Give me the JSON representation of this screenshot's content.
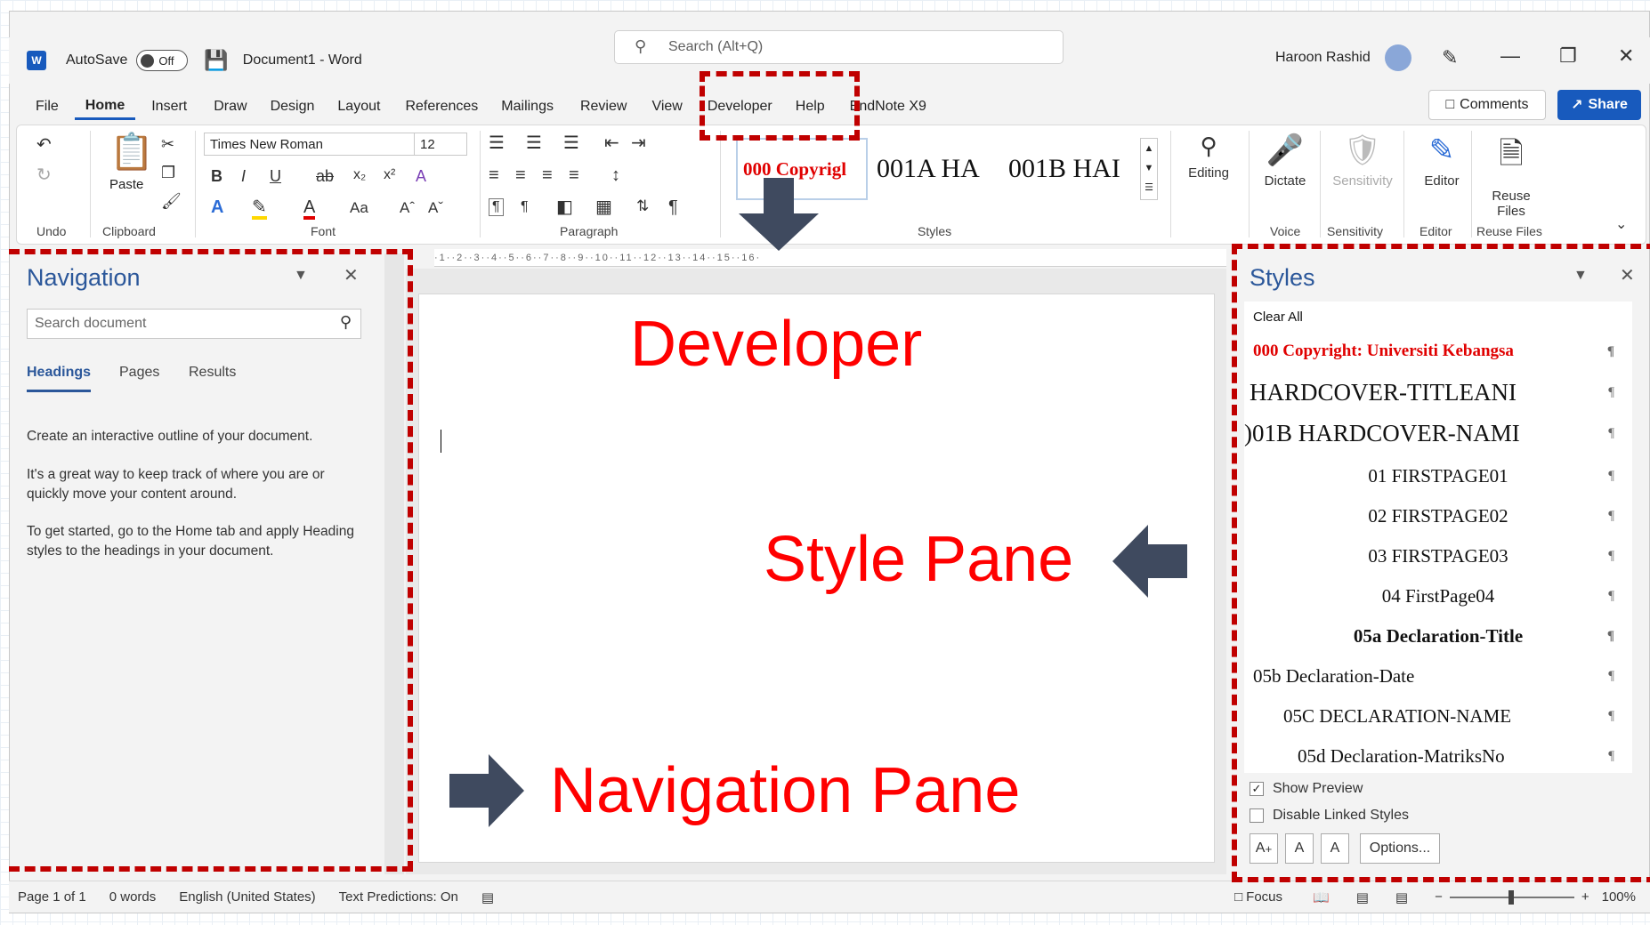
{
  "titlebar": {
    "autosave_label": "AutoSave",
    "autosave_state": "Off",
    "doc_title": "Document1 - Word",
    "search_placeholder": "Search (Alt+Q)",
    "user_name": "Haroon Rashid"
  },
  "tabs": [
    {
      "label": "File"
    },
    {
      "label": "Home"
    },
    {
      "label": "Insert"
    },
    {
      "label": "Draw"
    },
    {
      "label": "Design"
    },
    {
      "label": "Layout"
    },
    {
      "label": "References"
    },
    {
      "label": "Mailings"
    },
    {
      "label": "Review"
    },
    {
      "label": "View"
    },
    {
      "label": "Developer"
    },
    {
      "label": "Help"
    },
    {
      "label": "EndNote X9"
    }
  ],
  "actions": {
    "comments": "Comments",
    "share": "Share"
  },
  "ribbon": {
    "undo_group": "Undo",
    "clipboard_group": "Clipboard",
    "paste_label": "Paste",
    "font_name": "Times New Roman",
    "font_size": "12",
    "font_group": "Font",
    "paragraph_group": "Paragraph",
    "styles_group": "Styles",
    "style_gallery": [
      "000 Copyrigl",
      "001A HA",
      "001B HAI"
    ],
    "editing_label": "Editing",
    "dictate_label": "Dictate",
    "voice_group": "Voice",
    "sensitivity_label": "Sensitivity",
    "sensitivity_group": "Sensitivity",
    "editor_label": "Editor",
    "editor_group": "Editor",
    "reuse_label_1": "Reuse",
    "reuse_label_2": "Files",
    "reuse_group": "Reuse Files"
  },
  "navigation": {
    "title": "Navigation",
    "search_placeholder": "Search document",
    "tabs": [
      "Headings",
      "Pages",
      "Results"
    ],
    "p1": "Create an interactive outline of your document.",
    "p2": "It's a great way to keep track of where you are or quickly move your content around.",
    "p3": "To get started, go to the Home tab and apply Heading styles to the headings in your document."
  },
  "styles_pane": {
    "title": "Styles",
    "items": [
      "Clear All",
      "000 Copyright: Universiti Kebangsa",
      "HARDCOVER-TITLEANI",
      ")01B HARDCOVER-NAMI",
      "01 FIRSTPAGE01",
      "02 FIRSTPAGE02",
      "03 FIRSTPAGE03",
      "04 FirstPage04",
      "05a Declaration-Title",
      "05b Declaration-Date",
      "05C DECLARATION-NAME",
      "05d Declaration-MatriksNo"
    ],
    "show_preview": "Show Preview",
    "disable_linked": "Disable Linked Styles",
    "options": "Options..."
  },
  "status": {
    "page": "Page 1 of 1",
    "words": "0 words",
    "language": "English (United States)",
    "predictions": "Text Predictions: On",
    "focus": "Focus",
    "zoom": "100%"
  },
  "annotations": {
    "developer": "Developer",
    "style_pane": "Style Pane",
    "navigation_pane": "Navigation Pane"
  },
  "colors": {
    "accent": "#185abd",
    "annotation": "#ff0000",
    "dash": "#c00000",
    "arrow": "#3f4a5f"
  }
}
